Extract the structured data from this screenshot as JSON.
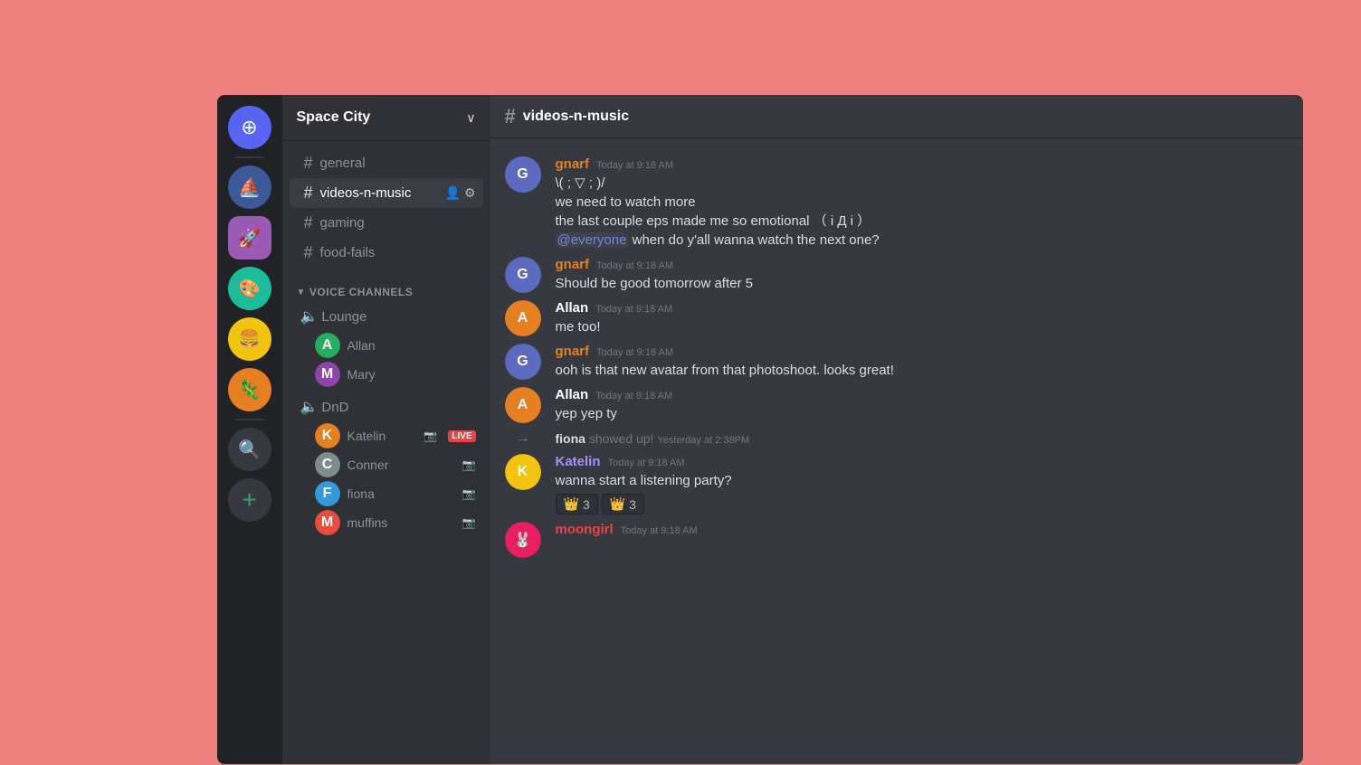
{
  "app": {
    "title": "DISCORD"
  },
  "server": {
    "name": "Space City",
    "chevron": "∨"
  },
  "channels": {
    "text_section": null,
    "items": [
      {
        "id": "general",
        "label": "general",
        "active": false
      },
      {
        "id": "videos-n-music",
        "label": "videos-n-music",
        "active": true
      },
      {
        "id": "gaming",
        "label": "gaming",
        "active": false
      },
      {
        "id": "food-fails",
        "label": "food-fails",
        "active": false
      }
    ],
    "voice_section": "VOICE CHANNELS",
    "voice_channels": [
      {
        "name": "Lounge",
        "users": [
          {
            "name": "Allan",
            "color": "#27ae60",
            "initial": "A",
            "has_camera": false,
            "live": false
          },
          {
            "name": "Mary",
            "color": "#8e44ad",
            "initial": "M",
            "has_camera": false,
            "live": false
          }
        ]
      },
      {
        "name": "DnD",
        "users": [
          {
            "name": "Katelin",
            "color": "#e67e22",
            "initial": "K",
            "has_camera": true,
            "live": true
          },
          {
            "name": "Conner",
            "color": "#7f8c8d",
            "initial": "C",
            "has_camera": true,
            "live": false
          },
          {
            "name": "fiona",
            "color": "#3498db",
            "initial": "F",
            "has_camera": true,
            "live": false
          },
          {
            "name": "muffins",
            "color": "#e74c3c",
            "initial": "M",
            "has_camera": true,
            "live": false
          }
        ]
      }
    ]
  },
  "chat": {
    "channel_name": "videos-n-music",
    "messages": [
      {
        "id": "msg1",
        "author": "gnarf",
        "author_color": "orange",
        "avatar_color": "#5c6bc0",
        "avatar_initial": "G",
        "timestamp": "Today at 9:18 AM",
        "lines": [
          "\\( ; ▽ ; )/",
          "we need to watch more",
          "the last couple eps made me so emotional （ i Д i ）",
          "@everyone when do y'all wanna watch the next one?"
        ],
        "has_mention": true,
        "mention_text": "@everyone"
      },
      {
        "id": "msg2",
        "author": "gnarf",
        "author_color": "orange",
        "avatar_color": "#5c6bc0",
        "avatar_initial": "G",
        "timestamp": "Today at 9:18 AM",
        "lines": [
          "Should be good tomorrow after 5"
        ],
        "has_mention": false
      },
      {
        "id": "msg3",
        "author": "Allan",
        "author_color": "default",
        "avatar_color": "#e67e22",
        "avatar_initial": "A",
        "timestamp": "Today at 9:18 AM",
        "lines": [
          "me too!"
        ],
        "has_mention": false
      },
      {
        "id": "msg4",
        "author": "gnarf",
        "author_color": "orange",
        "avatar_color": "#5c6bc0",
        "avatar_initial": "G",
        "timestamp": "Today at 9:18 AM",
        "lines": [
          "ooh is that new avatar from that photoshoot. looks great!"
        ],
        "has_mention": false
      },
      {
        "id": "msg5",
        "author": "Allan",
        "author_color": "default",
        "avatar_color": "#e67e22",
        "avatar_initial": "A",
        "timestamp": "Today at 9:18 AM",
        "lines": [
          "yep yep ty"
        ],
        "has_mention": false
      },
      {
        "id": "sys1",
        "type": "system",
        "text": "fiona",
        "action": " showed up!",
        "timestamp": "Yesterday at 2:38PM"
      },
      {
        "id": "msg6",
        "author": "Katelin",
        "author_color": "purple",
        "avatar_color": "#f1c40f",
        "avatar_initial": "K",
        "timestamp": "Today at 9:18 AM",
        "lines": [
          "wanna start a listening party?"
        ],
        "has_mention": false,
        "reactions": [
          {
            "emoji": "👑",
            "count": 3
          },
          {
            "emoji": "👑",
            "count": 3
          }
        ]
      },
      {
        "id": "msg7",
        "author": "moongirl",
        "author_color": "pink",
        "avatar_color": "#e91e63",
        "avatar_initial": "🐰",
        "timestamp": "Today at 9:18 AM",
        "lines": [],
        "has_mention": false
      }
    ]
  },
  "sidebar_servers": [
    {
      "id": "discord-home",
      "label": "Discord Home",
      "type": "discord"
    },
    {
      "id": "sailboat",
      "label": "Sailboat Server",
      "emoji": "⛵",
      "bg": "#3b5998"
    },
    {
      "id": "space",
      "label": "Space City",
      "emoji": "🚀",
      "bg": "#9b59b6"
    },
    {
      "id": "palette",
      "label": "Art Server",
      "emoji": "🎨",
      "bg": "#1abc9c"
    },
    {
      "id": "food",
      "label": "Food Server",
      "emoji": "🍔",
      "bg": "#f1c40f"
    },
    {
      "id": "creature",
      "label": "Creature Server",
      "emoji": "🦎",
      "bg": "#e67e22"
    }
  ],
  "icons": {
    "hash": "#",
    "chevron_down": "∨",
    "add": "+",
    "search": "🔍",
    "speaker": "🔈",
    "camera": "📷",
    "user_plus": "👤+",
    "settings": "⚙",
    "arrow_right": "→"
  }
}
